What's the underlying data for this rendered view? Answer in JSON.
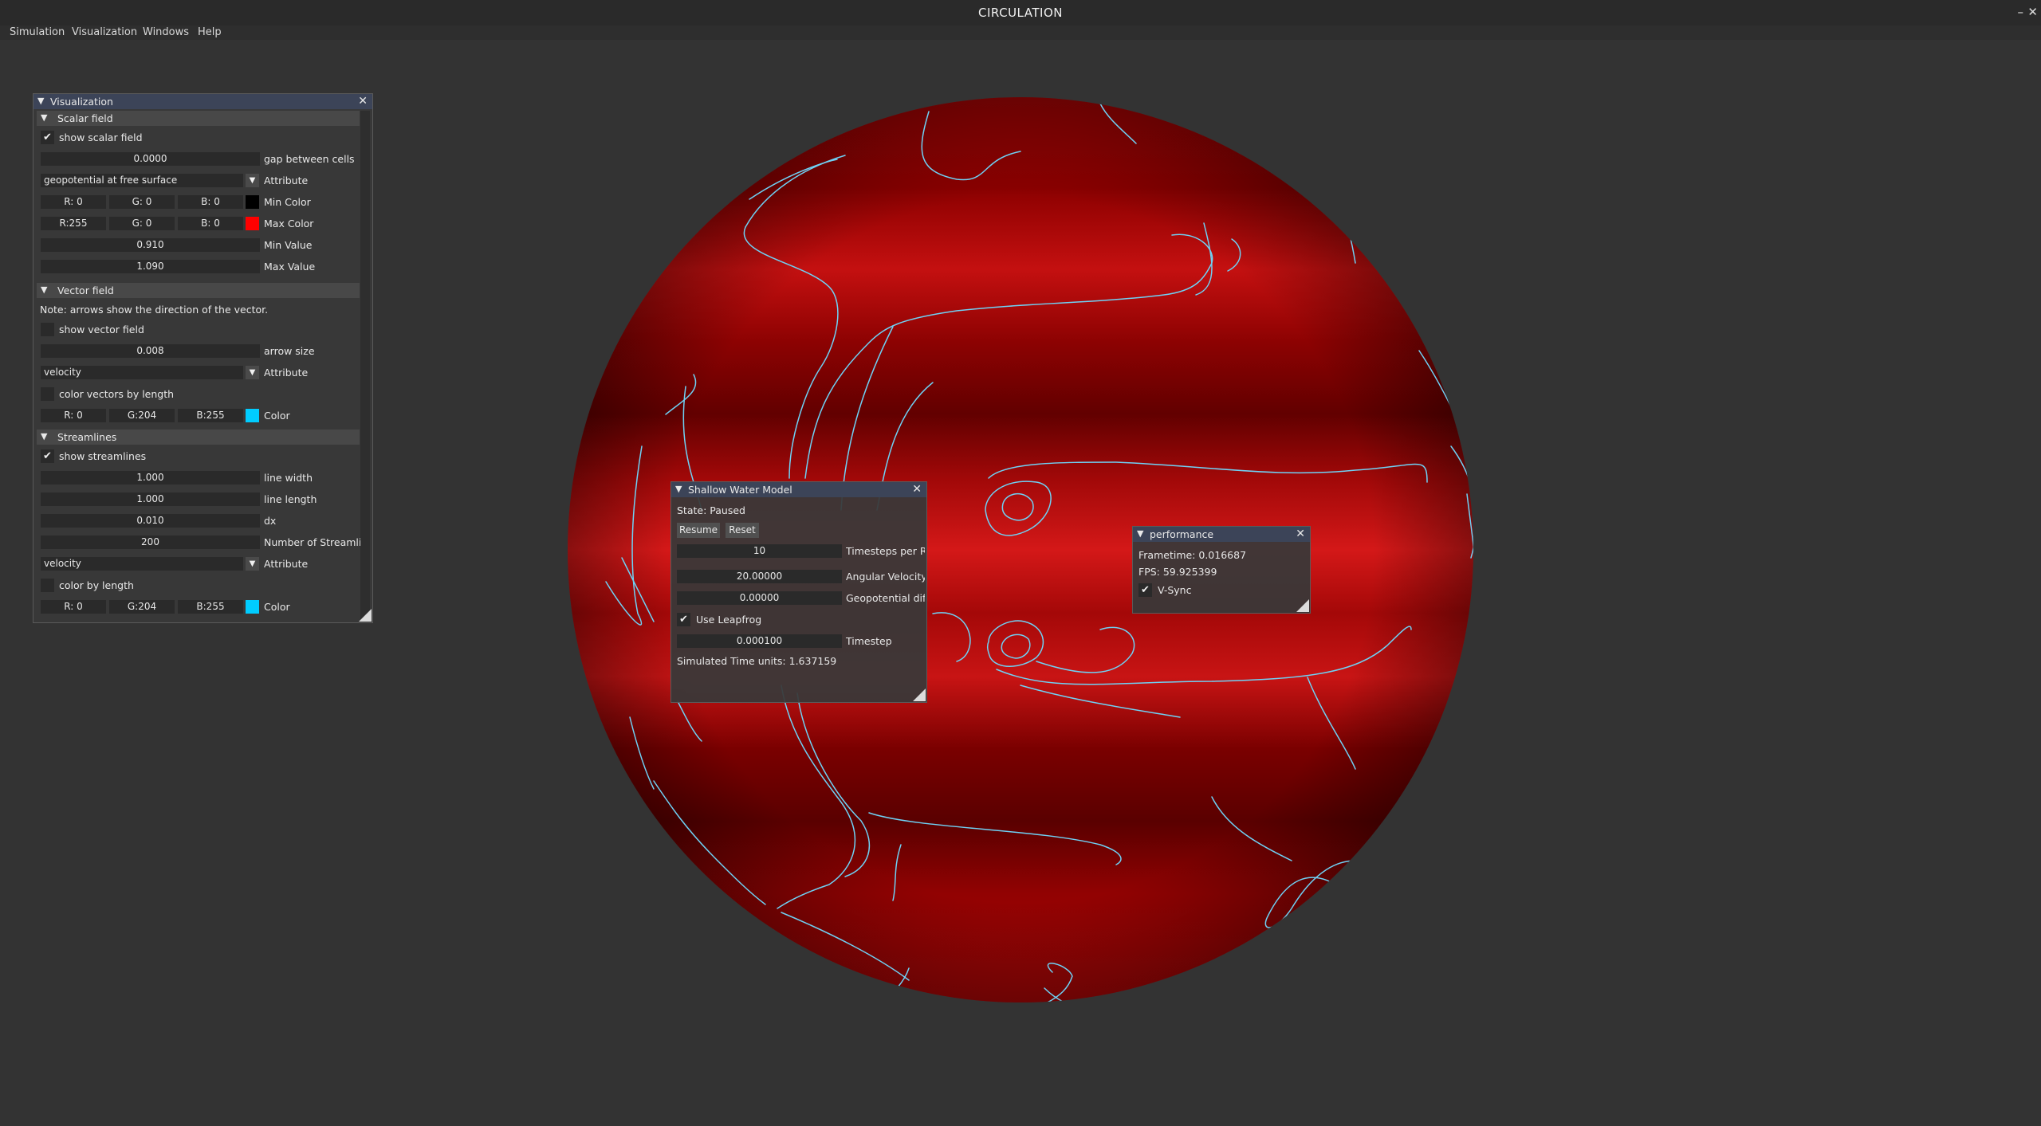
{
  "app": {
    "title": "CIRCULATION",
    "minimize": "–",
    "close": "✕"
  },
  "menu": {
    "items": [
      "Simulation",
      "Visualization",
      "Windows",
      "Help"
    ]
  },
  "colors": {
    "background": "#333333",
    "globe_min": "#000000",
    "globe_max": "#ff0000",
    "streamline": "#00ccff",
    "panel_header": "#3c4458"
  },
  "visualization_panel": {
    "title": "Visualization",
    "collapse_icon": "▼",
    "close_icon": "✕",
    "scalar": {
      "header": "Scalar field",
      "show_label": "show scalar field",
      "show_checked": "✔",
      "gap_value": "0.0000",
      "gap_label": "gap between cells",
      "attribute_value": "geopotential at free surface",
      "attribute_label": "Attribute",
      "min_color": {
        "r": "R:  0",
        "g": "G:  0",
        "b": "B:  0",
        "label": "Min Color",
        "hex": "#000000"
      },
      "max_color": {
        "r": "R:255",
        "g": "G:  0",
        "b": "B:  0",
        "label": "Max Color",
        "hex": "#ff0000"
      },
      "min_value": "0.910",
      "min_value_label": "Min Value",
      "max_value": "1.090",
      "max_value_label": "Max Value"
    },
    "vector": {
      "header": "Vector field",
      "note": "Note: arrows show the direction of the vector.",
      "show_label": "show vector field",
      "arrow_size": "0.008",
      "arrow_size_label": "arrow size",
      "attribute_value": "velocity",
      "attribute_label": "Attribute",
      "color_by_length_label": "color vectors by length",
      "color": {
        "r": "R:  0",
        "g": "G:204",
        "b": "B:255",
        "label": "Color",
        "hex": "#00ccff"
      }
    },
    "streamlines": {
      "header": "Streamlines",
      "show_label": "show streamlines",
      "show_checked": "✔",
      "line_width": "1.000",
      "line_width_label": "line width",
      "line_length": "1.000",
      "line_length_label": "line length",
      "dx": "0.010",
      "dx_label": "dx",
      "count": "200",
      "count_label": "Number of Streamlin",
      "attribute_value": "velocity",
      "attribute_label": "Attribute",
      "color_by_length_label": "color by length",
      "color": {
        "r": "R:  0",
        "g": "G:204",
        "b": "B:255",
        "label": "Color",
        "hex": "#00ccff"
      }
    }
  },
  "shallow_water_panel": {
    "title": "Shallow Water Model",
    "state": "State: Paused",
    "resume": "Resume",
    "reset": "Reset",
    "timesteps": "10",
    "timesteps_label": "Timesteps per Re",
    "angular_velocity": "20.00000",
    "angular_velocity_label": "Angular Velocity",
    "geopotential_diff": "0.00000",
    "geopotential_diff_label": "Geopotential diff",
    "leapfrog_checked": "✔",
    "leapfrog_label": "Use Leapfrog",
    "timestep": "0.000100",
    "timestep_label": "Timestep",
    "simulated_time": "Simulated Time units: 1.637159"
  },
  "performance_panel": {
    "title": "performance",
    "frametime": "Frametime: 0.016687",
    "fps": "FPS: 59.925399",
    "vsync_checked": "✔",
    "vsync_label": "V-Sync"
  }
}
